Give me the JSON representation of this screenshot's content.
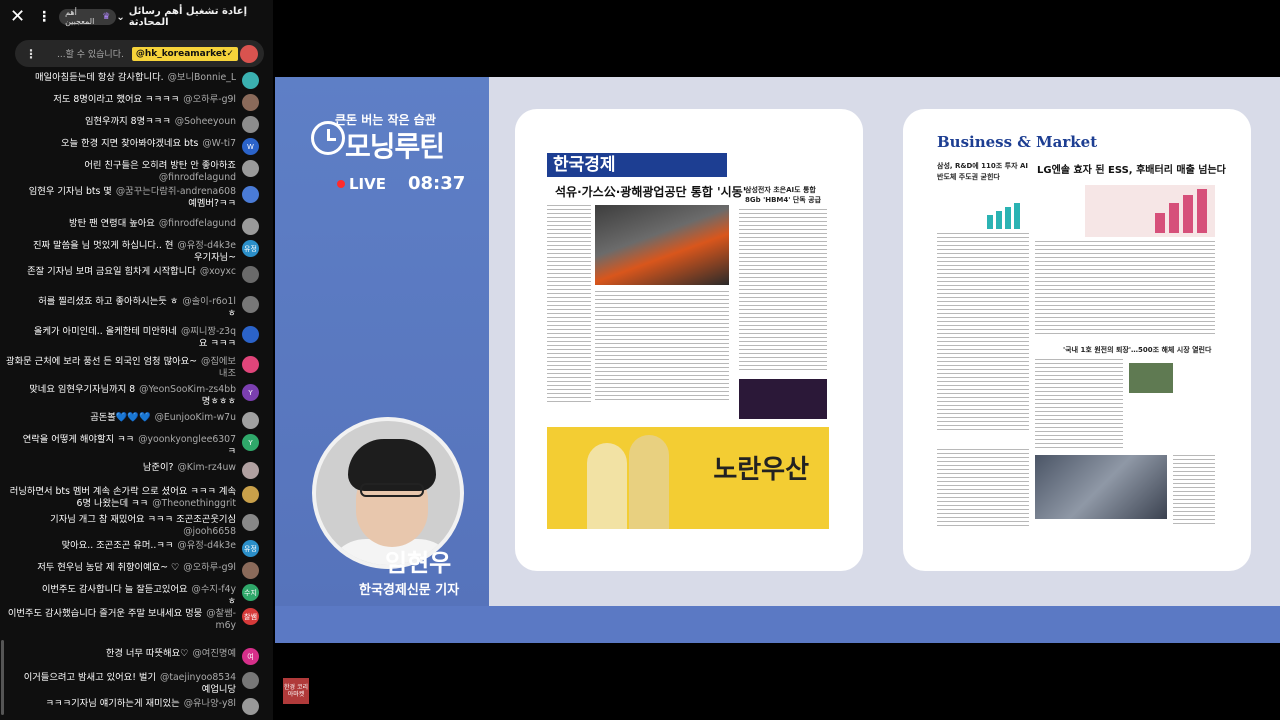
{
  "chat_header": {
    "title": "إعادة تشغيل أهم رسائل المحادثة",
    "badge": "أهم المعجبين"
  },
  "pinned": {
    "text": "...할 수 있습니다.",
    "author": "@hk_koreamarket✓"
  },
  "messages": [
    {
      "text": "매일아침듣는데 항상 감사합니다.",
      "author": "@보니Bonnie_L",
      "avatar_color": "#3ab0b0"
    },
    {
      "text": "저도 8명이라고 했어요 ㅋㅋㅋㅋ",
      "author": "@오하루-g9l",
      "avatar_color": "#8a6a5a"
    },
    {
      "text": "임현우까지 8명ㅋㅋㅋ",
      "author": "@Soheeyoun",
      "avatar_color": "#8c8c8c"
    },
    {
      "text": "오늘 한경 지면 찾아봐야겠네요 bts",
      "author": "@W-ti7",
      "avatar_color": "#2b63c9",
      "avatar_label": "W"
    },
    {
      "text": "어린 친구들은 오히려 방탄 안 좋아하죠",
      "author": "@finrodfelagund",
      "avatar_color": "#9a9a9a"
    },
    {
      "text": "임현우 기자님 bts 몇",
      "author": "@꿈꾸는다람쥐-andrena608",
      "extra": "예멤버?ㅋㅋ",
      "avatar_color": "#4a7bd6"
    },
    {
      "text": "방탄 팬 연령대 높아요",
      "author": "@finrodfelagund",
      "avatar_color": "#9a9a9a"
    },
    {
      "text": "진짜 말씀을 님 멋있게 하십니다.. 현",
      "author": "@유정-d4k3e",
      "extra": "우기자님~",
      "avatar_color": "#2b8fc9",
      "avatar_label": "유정"
    },
    {
      "text": "존잘 기자님 보며 금요일 힘차게 시작합니다",
      "author": "@xoyxc",
      "avatar_color": "#6a6a6a"
    },
    {
      "text": "허를 찔리셨죠 하고 좋아하시는듯 ㅎ",
      "author": "@솔이-r6o1l",
      "extra": "ㅎ",
      "avatar_color": "#777"
    },
    {
      "text": "올케가 아미인데.. 올케한테 미안하네",
      "author": "@찌니짱-z3q",
      "extra": "요 ㅋㅋㅋ",
      "avatar_color": "#2b63c9"
    },
    {
      "text": "광화문 근처에 보라 풍선 든 외국인 엄청 많아요~",
      "author": "@집에보내조",
      "extra": "",
      "avatar_color": "#e0457a"
    },
    {
      "text": "맞네요 임현우기자님까지 8",
      "author": "@YeonSooKim-zs4bb",
      "extra": "명ㅎㅎㅎ",
      "avatar_color": "#7b3fb0",
      "avatar_label": "Y"
    },
    {
      "text": "곰돈볼💙💙💙",
      "author": "@EunjooKim-w7u",
      "avatar_color": "#a0a0a0"
    },
    {
      "text": "연락을 어떻게 해야할지 ㅋㅋ",
      "author": "@yoonkyonglee6307",
      "extra": "ㅋ",
      "avatar_color": "#2fa86a",
      "avatar_label": "Y"
    },
    {
      "text": "남준이?",
      "author": "@Kim-rz4uw",
      "avatar_color": "#b0a0a0"
    },
    {
      "text": "러닝하면서 bts 멤버 계속 손가락 으로 셨어요 ㅋㅋㅋ 계속 6명 나왔는데 ㅋㅋ",
      "author": "@Theonethinggrit",
      "avatar_color": "#c9a04a"
    },
    {
      "text": "기자님 개그 참 재밌어요 ㅋㅋㅋ 조곤조곤웃기심",
      "author": "@jooh6658",
      "avatar_color": "#888"
    },
    {
      "text": "맞아요.. 조곤조곤 유머..ㅋㅋ",
      "author": "@유정-d4k3e",
      "avatar_color": "#2b8fc9",
      "avatar_label": "유정"
    },
    {
      "text": "저두 현우님 농담 제 취향이예요~ ♡",
      "author": "@오하루-g9l",
      "avatar_color": "#8a6a5a"
    },
    {
      "text": "이번주도 감사합니다 늘 잘듣고있어요",
      "author": "@수지-f4y",
      "extra": "ㅎ",
      "avatar_color": "#2fa86a",
      "avatar_label": "수지"
    },
    {
      "text": "이번주도 감사했습니다 즐거운 주말 보내세요 멍뭉",
      "author": "@찰쌤-m6y",
      "extra": "",
      "avatar_color": "#d63a3a",
      "avatar_label": "찰쌤"
    },
    {
      "text": "한경 너무 따뜻해요♡",
      "author": "@여진명예",
      "avatar_color": "#d62f8a",
      "avatar_label": "여"
    },
    {
      "text": "이거들으려고 밤새고 있어요! 벌기",
      "author": "@taejinyoo8534",
      "extra": "예업니당",
      "avatar_color": "#777"
    },
    {
      "text": "ㅋㅋㅋ기자님 얘기하는게 재미있는",
      "author": "@유나양-y8l",
      "avatar_color": "#999"
    }
  ],
  "video": {
    "promo_tagline": "큰돈 버는 작은 습관",
    "promo_title": "모닝루틴",
    "live_label": "LIVE",
    "live_time": "08:37",
    "host_name": "임현우",
    "host_role": "한국경제신문 기자"
  },
  "newspaper_front": {
    "masthead": "한국경제",
    "headline": "석유·가스公·광해광업공단 통합 '시동'",
    "sidebar_head": "삼성전자 초은AI도 통합 8Gb 'HBM4' 단독 공급",
    "ad_title": "노란우산"
  },
  "newspaper_back": {
    "section": "Business & Market",
    "lead_head": "삼성, R&D에 110조 투자 AI 반도체 주도권 굳힌다",
    "head1": "LG엔솔 효자 된 ESS, 후배터리 매출 넘는다",
    "head2": "'국내 1호 원전의 퇴장'…500조 해체 시장 열린다"
  },
  "bottom_badge": "한경 코리아마켓"
}
